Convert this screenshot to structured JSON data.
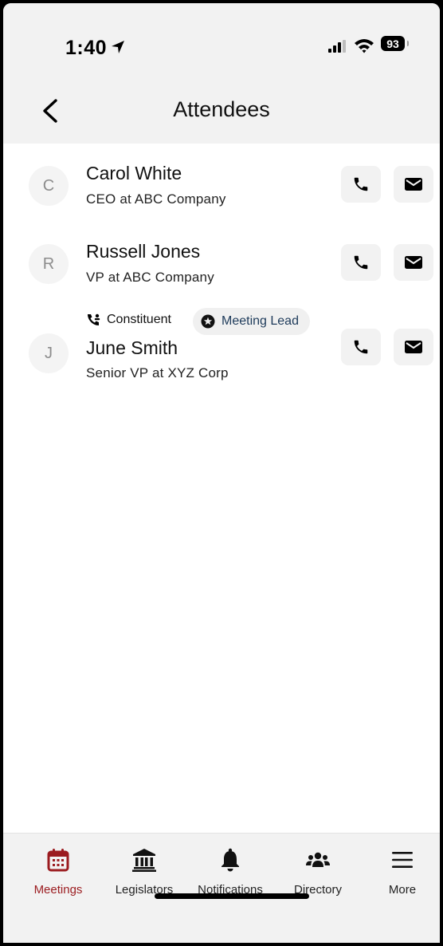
{
  "status_bar": {
    "time": "1:40",
    "battery": "93"
  },
  "header": {
    "title": "Attendees"
  },
  "attendees": [
    {
      "initial": "C",
      "name": "Carol White",
      "subtitle": "CEO at ABC Company"
    },
    {
      "initial": "R",
      "name": "Russell Jones",
      "subtitle": "VP at ABC Company"
    },
    {
      "initial": "J",
      "name": "June Smith",
      "subtitle": "Senior VP at XYZ Corp",
      "tags": [
        "Constituent",
        "Meeting Lead"
      ]
    }
  ],
  "tabs": [
    {
      "label": "Meetings",
      "icon": "calendar-icon",
      "active": true
    },
    {
      "label": "Legislators",
      "icon": "capitol-building-icon"
    },
    {
      "label": "Notifications",
      "icon": "bell-icon"
    },
    {
      "label": "Directory",
      "icon": "people-group-icon"
    },
    {
      "label": "More",
      "icon": "hamburger-menu-icon"
    }
  ],
  "colors": {
    "accent": "#9b1b1f",
    "background": "#ffffff",
    "bar_background": "#f2f2f2",
    "lead_tag_text": "#1d3a5a"
  }
}
